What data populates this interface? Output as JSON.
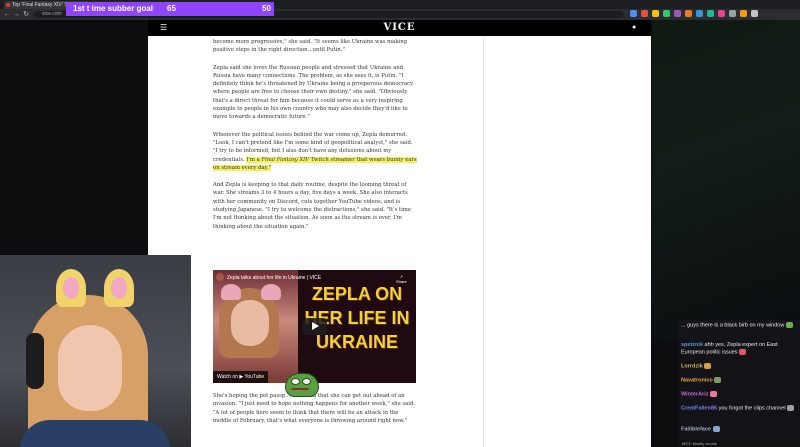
{
  "browser": {
    "tab_title": "Top 'Final Fantasy XIV' Streamer",
    "url": "vice.com",
    "ext_colors": [
      "#4b8cf5",
      "#e74c3c",
      "#f1c40f",
      "#2ecc71",
      "#9b59b6",
      "#e67e22",
      "#3498db",
      "#1abc9c",
      "#e84393",
      "#95a5a6",
      "#f39c12",
      "#bdc3c7"
    ]
  },
  "goal": {
    "title": "1st t ime subber goal",
    "current": "65",
    "target": "50",
    "progress": 1.0
  },
  "site": {
    "logo": "VICE",
    "menu_icon": "hamburger-icon",
    "user_icon": "user-icon"
  },
  "article": {
    "p1": "become more progressive,\" she said. \"It seems like Ukraine was making positive steps in the right direction...until Putin.\"",
    "p2": "Zepla said she loves the Russian people and stressed that Ukraine and Russia have many connections. The problem, as she sees it, is Putin. \"I definitely think he's threatened by Ukraine being a prosperous democracy where people are free to choose their own destiny,\" she said. \"Obviously that's a direct threat for him because it could serve as a very inspiring example to people in his own country who may also decide they'd like to move towards a democratic future.\"",
    "p3": "Whenever the political issues behind the war come up, Zepla demurred. \"Look, I can't pretend like I'm some kind of geopolitical analyst,\" she said. \"I try to be informed, but I also don't have any delusions about my credentials.",
    "p3_highlight_a": "I'm a ",
    "p3_highlight_em": "Final Fantasy XIV",
    "p3_highlight_b": " Twitch streamer that wears bunny ears on stream every day.\"",
    "p4": "And Zepla is keeping to that daily routine, despite the looming threat of war. She streams 3 to 4 hours a day, five days a week. She also interacts with her community on Discord, cuts together YouTube videos, and is studying Japanese. \"I try to welcome the distractions,\" she said. \"It's time I'm not thinking about the situation. As soon as the stream is over, I'm thinking about the situation again.\"",
    "p5": "She's hoping the pet passp... soon and that she can get out ahead of an invasion. \"I just need to hope nothing happens for another week,\" she said. \"A lot of people here seem to think that there will be an attack in the middle of February, that's what everyone is throwing around right now.\""
  },
  "video": {
    "title": "Zepla talks about her life in Ukraine | VICE",
    "share_label": "Share",
    "big_text": "ZEPLA ON HER LIFE IN UKRAINE",
    "watch_on": "Watch on ▶ YouTube"
  },
  "chat": {
    "messages": [
      {
        "user": "",
        "text": "... guys there is a black birb on my window",
        "color": "#cccccc"
      },
      {
        "user": "spetznik",
        "text": "ahh yes, Zepla expert on East European politic issues",
        "color": "#5e8fdd"
      },
      {
        "user": "Lorrdzik",
        "text": "",
        "color": "#d9b24a"
      },
      {
        "user": "Navatronico",
        "text": "",
        "color": "#e0a646"
      },
      {
        "user": "WinterAriz",
        "text": "",
        "color": "#c46bd8"
      },
      {
        "user": "CreatFallen86",
        "text": "you forgot the clips channel",
        "color": "#7a7cf0"
      },
      {
        "user": "Fallibleface",
        "text": "",
        "color": "#9fb0c8"
      }
    ],
    "footer": "MOT: Mostly clouds"
  }
}
